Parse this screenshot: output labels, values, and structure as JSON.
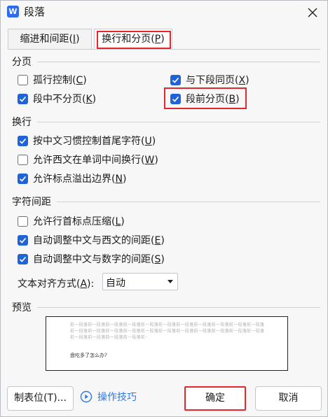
{
  "window": {
    "title": "段落",
    "app_icon_letter": "W"
  },
  "tabs": [
    {
      "label_main": "缩进和间距(",
      "label_key": "I",
      "label_end": ")"
    },
    {
      "label_main": "换行和分页(",
      "label_key": "P",
      "label_end": ")"
    }
  ],
  "pagination": {
    "header": "分页",
    "orphan": {
      "main": "孤行控制(",
      "key": "C",
      "end": ")",
      "checked": false
    },
    "keep_next": {
      "main": "与下段同页(",
      "key": "X",
      "end": ")",
      "checked": true
    },
    "keep_together": {
      "main": "段中不分页(",
      "key": "K",
      "end": ")",
      "checked": true
    },
    "page_break_before": {
      "main": "段前分页(",
      "key": "B",
      "end": ")",
      "checked": true
    }
  },
  "line_break": {
    "header": "换行",
    "chinese_rules": {
      "main": "按中文习惯控制首尾字符(",
      "key": "U",
      "end": ")",
      "checked": true
    },
    "word_break": {
      "main": "允许西文在单词中间换行(",
      "key": "W",
      "end": ")",
      "checked": false
    },
    "punct_overflow": {
      "main": "允许标点溢出边界(",
      "key": "N",
      "end": ")",
      "checked": true
    }
  },
  "char_spacing": {
    "header": "字符间距",
    "compress_punct": {
      "main": "允许行首标点压缩(",
      "key": "L",
      "end": ")",
      "checked": false
    },
    "auto_cn_en": {
      "main": "自动调整中文与西文的间距(",
      "key": "E",
      "end": ")",
      "checked": true
    },
    "auto_cn_num": {
      "main": "自动调整中文与数字的间距(",
      "key": "S",
      "end": ")",
      "checked": true
    },
    "align_label_main": "文本对齐方式(",
    "align_label_key": "A",
    "align_label_end": "):",
    "align_value": "自动"
  },
  "preview": {
    "header": "预览",
    "sample_line": "前一段落前一段落前一段落前一段落前一段落前一段落前一段落前一段落前一段落前一段落前一段落",
    "main_text": "盘吃多了怎么办?"
  },
  "buttons": {
    "tabs": "制表位(T)...",
    "tips": "操作技巧",
    "ok": "确定",
    "cancel": "取消"
  }
}
